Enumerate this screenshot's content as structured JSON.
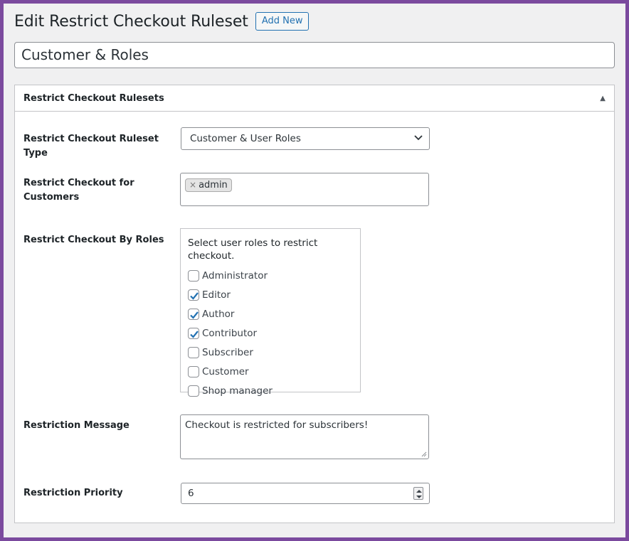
{
  "page": {
    "title": "Edit Restrict Checkout Ruleset",
    "add_new_label": "Add New",
    "post_title": "Customer & Roles"
  },
  "metabox": {
    "title": "Restrict Checkout Rulesets",
    "toggle_icon": "triangle-up-icon",
    "fields": {
      "ruleset_type": {
        "label": "Restrict Checkout Ruleset Type",
        "selected": "Customer & User Roles"
      },
      "customers": {
        "label": "Restrict Checkout for Customers",
        "tags": [
          {
            "remove": "×",
            "label": "admin"
          }
        ]
      },
      "roles": {
        "label": "Restrict Checkout By Roles",
        "heading": "Select user roles to restrict checkout.",
        "items": [
          {
            "label": "Administrator",
            "checked": false
          },
          {
            "label": "Editor",
            "checked": true
          },
          {
            "label": "Author",
            "checked": true
          },
          {
            "label": "Contributor",
            "checked": true
          },
          {
            "label": "Subscriber",
            "checked": false
          },
          {
            "label": "Customer",
            "checked": false
          },
          {
            "label": "Shop manager",
            "checked": false
          }
        ]
      },
      "message": {
        "label": "Restriction Message",
        "value": "Checkout is restricted for subscribers!"
      },
      "priority": {
        "label": "Restriction Priority",
        "value": "6"
      }
    }
  },
  "colors": {
    "frame_border": "#7b4a9e",
    "accent": "#2271b1",
    "background": "#f0f0f1"
  }
}
